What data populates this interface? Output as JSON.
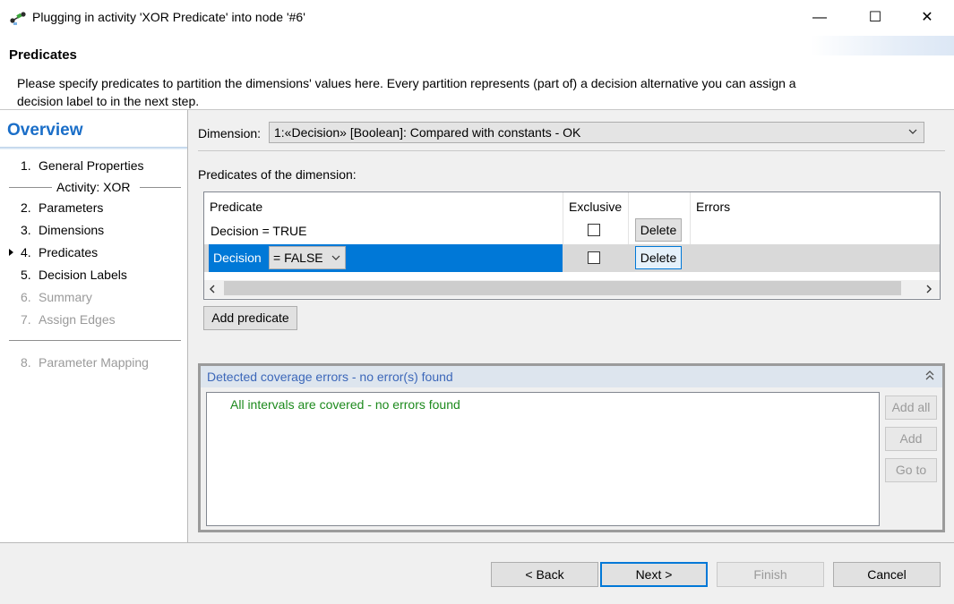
{
  "window": {
    "title": "Plugging in activity 'XOR Predicate' into node '#6'",
    "controls": {
      "minimize": "—",
      "maximize": "☐",
      "close": "✕"
    },
    "icon": "plug-node-icon"
  },
  "header": {
    "title": "Predicates",
    "description": "Please specify predicates to partition the dimensions' values here. Every partition represents (part of) a decision alternative you can assign a decision label to in the next step."
  },
  "sidebar": {
    "title": "Overview",
    "activity_label": "Activity: XOR",
    "items": [
      {
        "num": "1.",
        "label": "General Properties",
        "enabled": true
      },
      {
        "num": "2.",
        "label": "Parameters",
        "enabled": true
      },
      {
        "num": "3.",
        "label": "Dimensions",
        "enabled": true
      },
      {
        "num": "4.",
        "label": "Predicates",
        "enabled": true,
        "current": true
      },
      {
        "num": "5.",
        "label": "Decision Labels",
        "enabled": true
      },
      {
        "num": "6.",
        "label": "Summary",
        "enabled": false
      },
      {
        "num": "7.",
        "label": "Assign Edges",
        "enabled": false
      },
      {
        "num": "8.",
        "label": "Parameter Mapping",
        "enabled": false
      }
    ]
  },
  "main": {
    "dimension_label": "Dimension:",
    "dimension_value": "1:«Decision» [Boolean]: Compared with constants  -  OK",
    "predicates_label": "Predicates of the dimension:",
    "table": {
      "columns": [
        "Predicate",
        "Exclusive",
        "",
        "Errors"
      ],
      "rows": [
        {
          "predicate": "Decision = TRUE",
          "exclusive": false,
          "action": "Delete",
          "errors": ""
        },
        {
          "predicate_var": "Decision",
          "predicate_op": "= FALSE",
          "exclusive": false,
          "action": "Delete",
          "errors": "",
          "selected": true
        }
      ]
    },
    "add_predicate_label": "Add predicate"
  },
  "coverage": {
    "title": "Detected coverage errors - no error(s) found",
    "message": "All intervals are covered - no errors found",
    "buttons": {
      "add_all": "Add all",
      "add": "Add",
      "go_to": "Go to"
    }
  },
  "footer": {
    "back": "< Back",
    "next": "Next >",
    "finish": "Finish",
    "cancel": "Cancel"
  },
  "colors": {
    "accent": "#0078d7",
    "overview_title": "#1a6ec8",
    "coverage_title": "#3c67b9",
    "success_text": "#1d8a1d"
  }
}
